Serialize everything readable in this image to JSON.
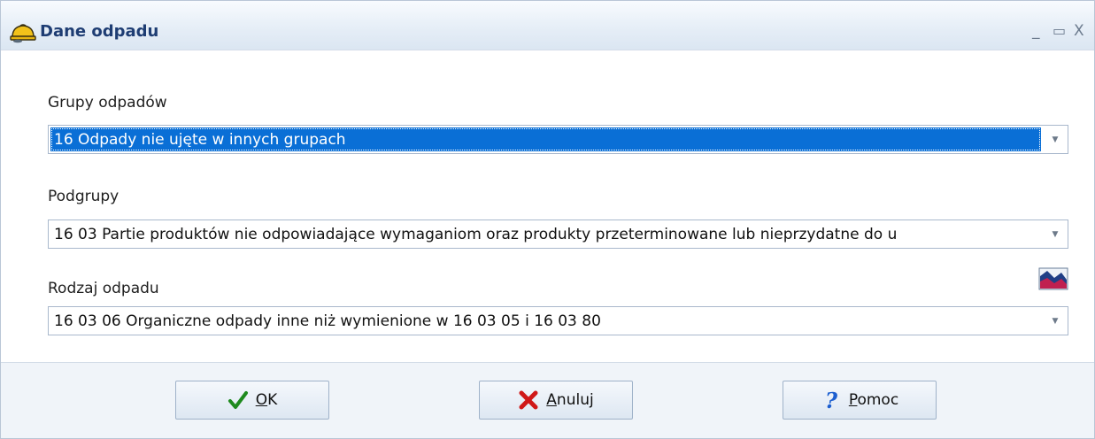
{
  "window": {
    "title": "Dane odpadu",
    "minimize_glyph": "_",
    "maximize_glyph": "▭",
    "close_glyph": "X"
  },
  "fields": {
    "groups": {
      "label": "Grupy odpadów",
      "value": "16 Odpady nie ujęte w innych grupach"
    },
    "subgroups": {
      "label": "Podgrupy",
      "value": "16 03 Partie produktów nie odpowiadające wymaganiom oraz produkty przeterminowane lub nieprzydatne do u"
    },
    "waste_type": {
      "label": "Rodzaj odpadu",
      "value": "16 03 06  Organiczne odpady inne niż wymienione w 16 03 05 i 16 03 80"
    }
  },
  "buttons": {
    "ok": {
      "mnemonic": "O",
      "rest": "K"
    },
    "cancel": {
      "mnemonic": "A",
      "rest": "nuluj"
    },
    "help": {
      "mnemonic": "P",
      "rest": "omoc"
    }
  },
  "icons": {
    "app": "hard-hat-icon",
    "chart": "chart-icon",
    "ok": "checkmark-icon",
    "cancel": "red-x-icon",
    "help": "question-mark-icon"
  },
  "colors": {
    "title_text": "#1e3d73",
    "selection": "#0a6fd6",
    "ok_check": "#1e8a1e",
    "cancel_x": "#d01818",
    "help_q": "#1d5fd0"
  }
}
